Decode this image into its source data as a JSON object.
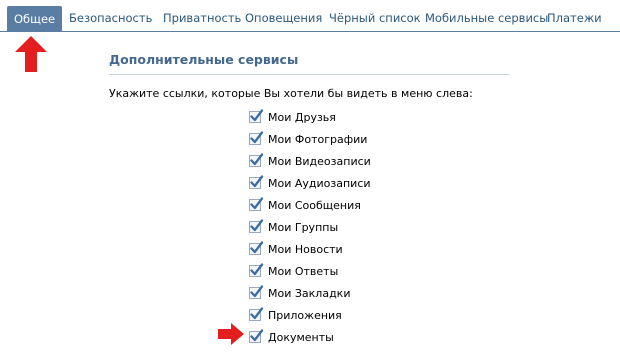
{
  "tabs": [
    {
      "label": "Общее",
      "active": true
    },
    {
      "label": "Безопасность",
      "active": false
    },
    {
      "label": "Приватность",
      "active": false
    },
    {
      "label": "Оповещения",
      "active": false
    },
    {
      "label": "Чёрный список",
      "active": false
    },
    {
      "label": "Мобильные сервисы",
      "active": false
    },
    {
      "label": "Платежи",
      "active": false
    }
  ],
  "section": {
    "title": "Дополнительные сервисы",
    "instructions": "Укажите ссылки, которые Вы хотели бы видеть в меню слева:"
  },
  "services": [
    {
      "label": "Мои Друзья",
      "checked": true
    },
    {
      "label": "Мои Фотографии",
      "checked": true
    },
    {
      "label": "Мои Видеозаписи",
      "checked": true
    },
    {
      "label": "Мои Аудиозаписи",
      "checked": true
    },
    {
      "label": "Мои Сообщения",
      "checked": true
    },
    {
      "label": "Мои Группы",
      "checked": true
    },
    {
      "label": "Мои Новости",
      "checked": true
    },
    {
      "label": "Мои Ответы",
      "checked": true
    },
    {
      "label": "Мои Закладки",
      "checked": true
    },
    {
      "label": "Приложения",
      "checked": true
    },
    {
      "label": "Документы",
      "checked": true
    }
  ],
  "colors": {
    "accent": "#597da3",
    "link": "#2b587a",
    "section_title": "#45688e",
    "arrow": "#e41e1e",
    "check": "#3b6ea5"
  },
  "icons": {
    "tab_pointer": "red-up-arrow-icon",
    "item_pointer": "red-right-arrow-icon",
    "checkbox": "checkmark-icon"
  }
}
